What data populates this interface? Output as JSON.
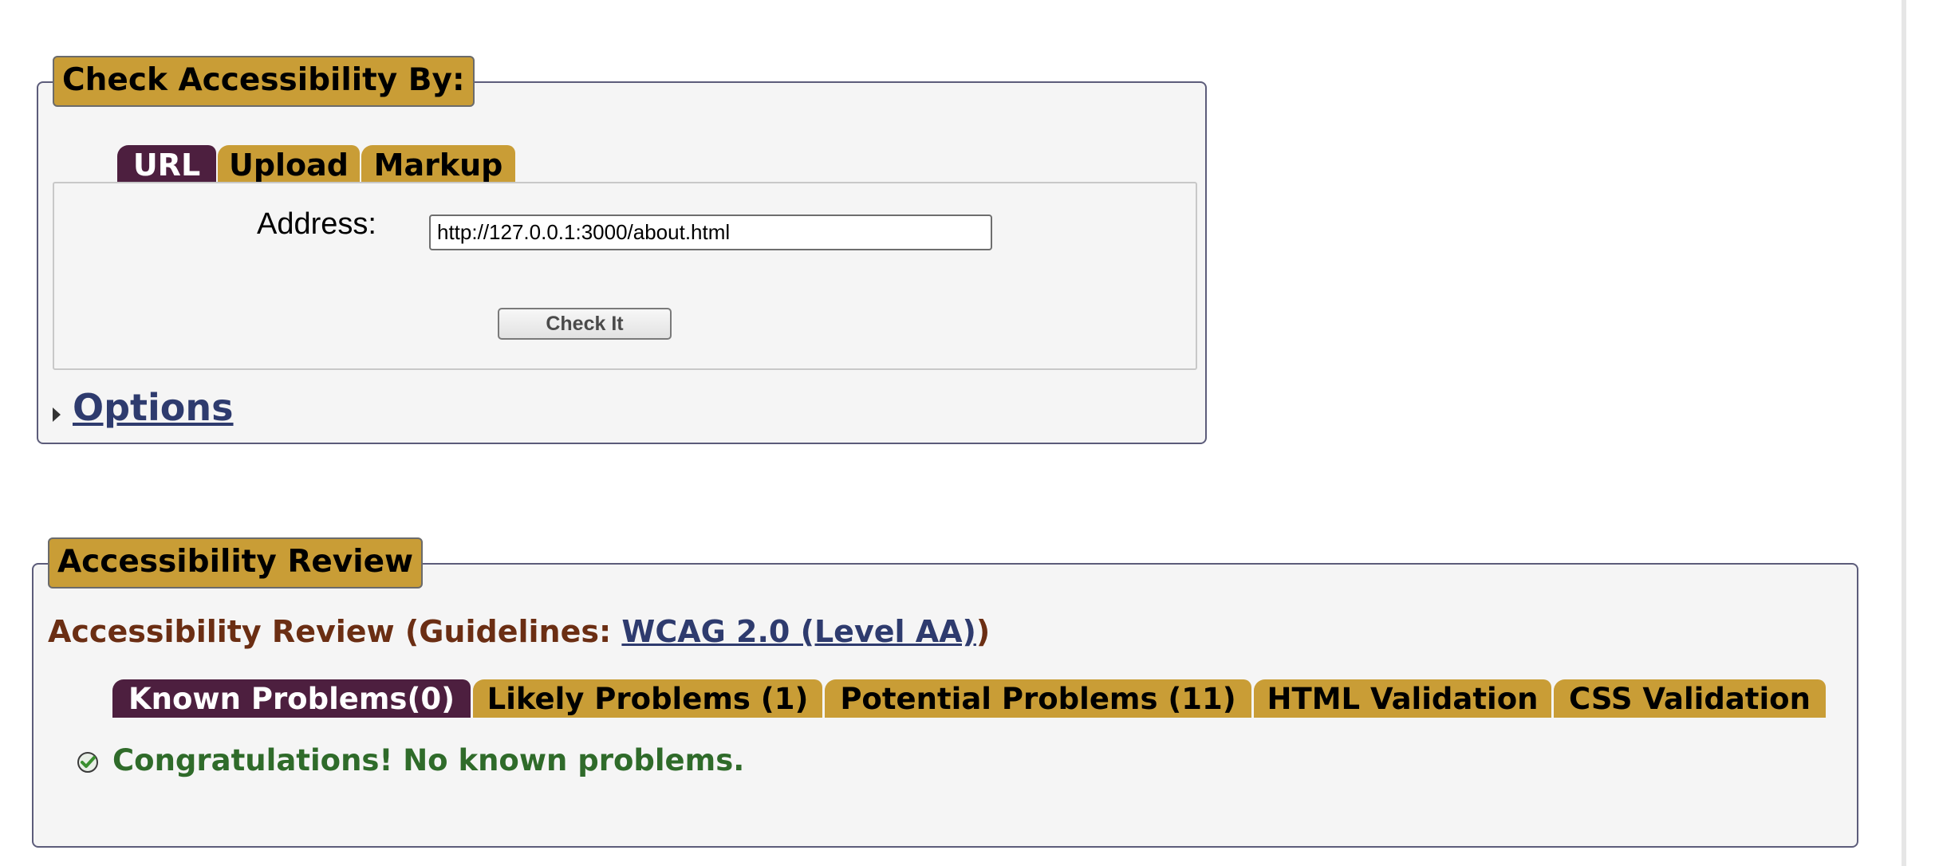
{
  "check_panel": {
    "legend": "Check Accessibility By:",
    "tabs": [
      {
        "label": "URL",
        "active": true
      },
      {
        "label": "Upload",
        "active": false
      },
      {
        "label": "Markup",
        "active": false
      }
    ],
    "address_label": "Address:",
    "address_value": "http://127.0.0.1:3000/about.html",
    "check_button": "Check It",
    "options_link": "Options"
  },
  "review_panel": {
    "legend": "Accessibility Review",
    "heading_prefix": "Accessibility Review (Guidelines: ",
    "guideline_link": "WCAG 2.0 (Level AA)",
    "heading_suffix": ")",
    "tabs": [
      {
        "label": "Known Problems(0)",
        "active": true
      },
      {
        "label": "Likely Problems (1)",
        "active": false
      },
      {
        "label": "Potential Problems (11)",
        "active": false
      },
      {
        "label": "HTML Validation",
        "active": false
      },
      {
        "label": "CSS Validation",
        "active": false
      }
    ],
    "message": "Congratulations! No known problems."
  },
  "colors": {
    "tab_gold": "#c99d36",
    "tab_active": "#4d1f3f",
    "heading_brown": "#6b2e13",
    "link_blue": "#2e3b6e",
    "success_green": "#2f6b2a"
  },
  "icons": {
    "options_toggle": "triangle-right-icon",
    "success": "check-circle-icon"
  }
}
